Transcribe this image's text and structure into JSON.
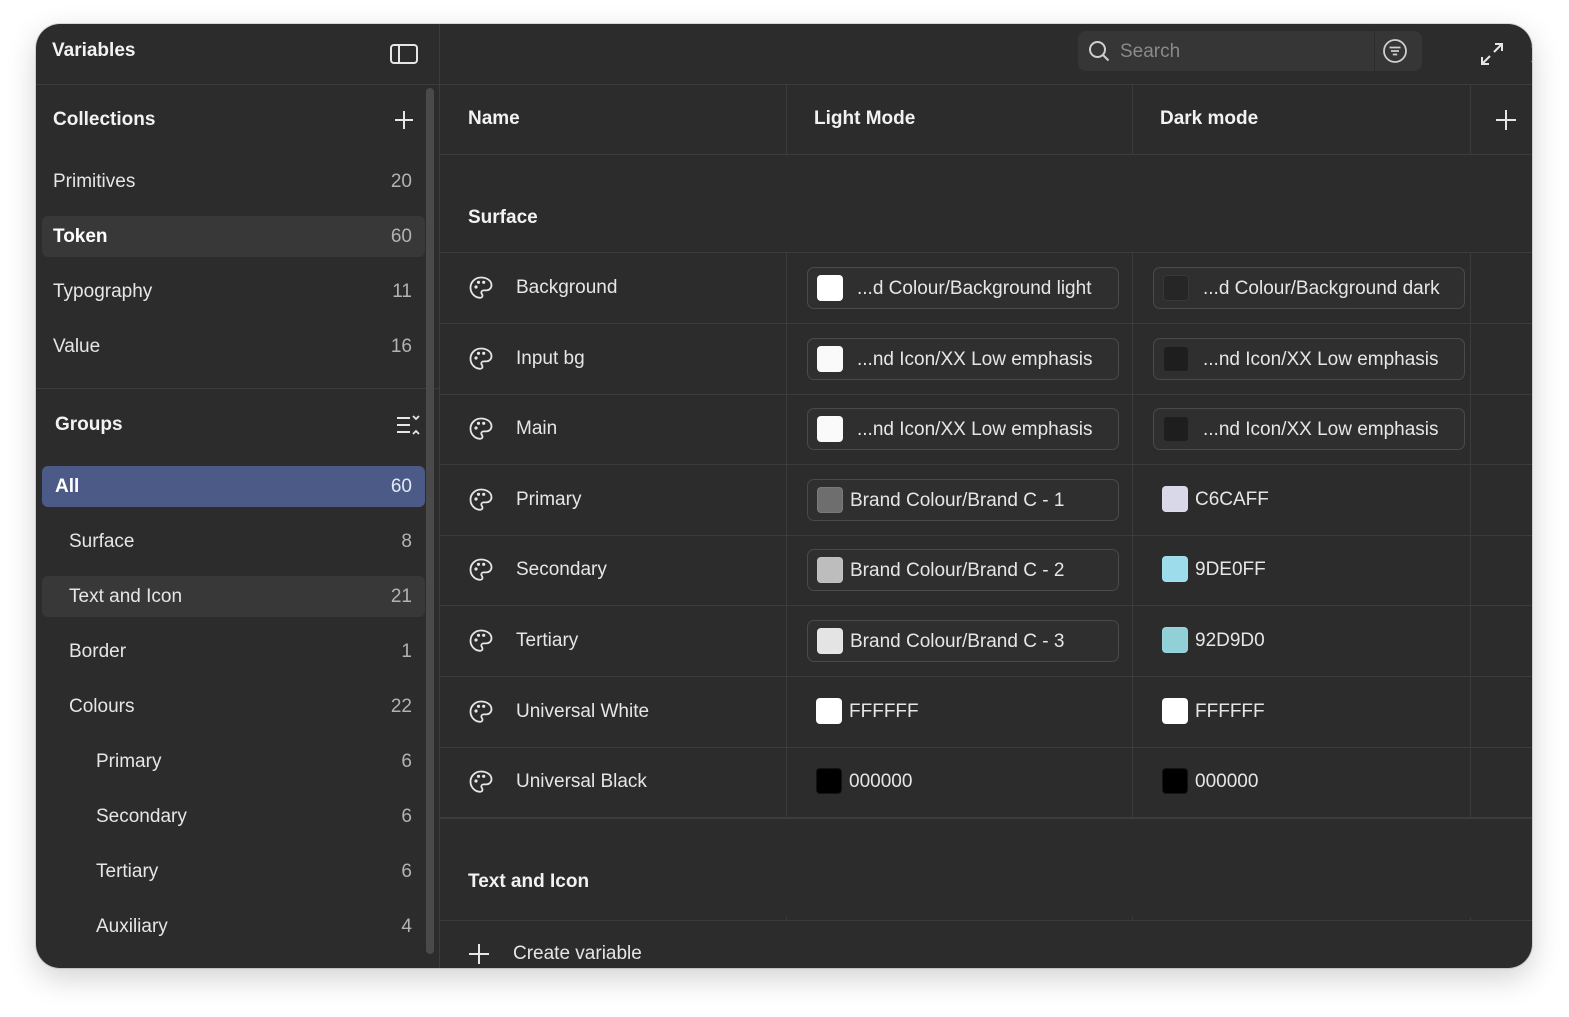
{
  "sidebar": {
    "title": "Variables",
    "collections_label": "Collections",
    "collections": [
      {
        "label": "Primitives",
        "count": "20"
      },
      {
        "label": "Token",
        "count": "60"
      },
      {
        "label": "Typography",
        "count": "11"
      },
      {
        "label": "Value",
        "count": "16"
      }
    ],
    "groups_label": "Groups",
    "groups": [
      {
        "label": "All",
        "count": "60"
      },
      {
        "label": "Surface",
        "count": "8"
      },
      {
        "label": "Text and Icon",
        "count": "21"
      },
      {
        "label": "Border",
        "count": "1"
      },
      {
        "label": "Colours",
        "count": "22"
      },
      {
        "label": "Primary",
        "count": "6"
      },
      {
        "label": "Secondary",
        "count": "6"
      },
      {
        "label": "Tertiary",
        "count": "6"
      },
      {
        "label": "Auxiliary",
        "count": "4"
      }
    ]
  },
  "search": {
    "placeholder": "Search"
  },
  "columns": {
    "name": "Name",
    "light": "Light Mode",
    "dark": "Dark mode"
  },
  "groups": [
    {
      "title": "Surface",
      "rows": [
        {
          "name": "Background",
          "light": {
            "type": "alias",
            "text": "...d Colour/Background light",
            "color": "#ffffff"
          },
          "dark": {
            "type": "alias",
            "text": "...d Colour/Background dark",
            "color": "#262626"
          }
        },
        {
          "name": "Input bg",
          "light": {
            "type": "alias",
            "text": "...nd Icon/XX Low emphasis",
            "color": "#fafafa"
          },
          "dark": {
            "type": "alias",
            "text": "...nd Icon/XX Low emphasis",
            "color": "#1e1e1e"
          }
        },
        {
          "name": "Main",
          "light": {
            "type": "alias",
            "text": "...nd Icon/XX Low emphasis",
            "color": "#fafafa"
          },
          "dark": {
            "type": "alias",
            "text": "...nd Icon/XX Low emphasis",
            "color": "#1e1e1e"
          }
        },
        {
          "name": "Primary",
          "light": {
            "type": "alias",
            "text": "Brand Colour/Brand C - 1",
            "color": "#6e6e6e"
          },
          "dark": {
            "type": "hex",
            "text": "C6CAFF",
            "color": "#d8d8e8"
          }
        },
        {
          "name": "Secondary",
          "light": {
            "type": "alias",
            "text": "Brand Colour/Brand C - 2",
            "color": "#bdbdbd"
          },
          "dark": {
            "type": "hex",
            "text": "9DE0FF",
            "color": "#9ddcea"
          }
        },
        {
          "name": "Tertiary",
          "light": {
            "type": "alias",
            "text": "Brand Colour/Brand C - 3",
            "color": "#e4e4e4"
          },
          "dark": {
            "type": "hex",
            "text": "92D9D0",
            "color": "#92d0d8"
          }
        },
        {
          "name": "Universal White",
          "light": {
            "type": "hex",
            "text": "FFFFFF",
            "color": "#ffffff"
          },
          "dark": {
            "type": "hex",
            "text": "FFFFFF",
            "color": "#ffffff"
          }
        },
        {
          "name": "Universal Black",
          "light": {
            "type": "hex",
            "text": "000000",
            "color": "#000000"
          },
          "dark": {
            "type": "hex",
            "text": "000000",
            "color": "#000000"
          }
        }
      ]
    },
    {
      "title": "Text and Icon",
      "rows": []
    }
  ],
  "create_label": "Create variable",
  "colors": {
    "selected": "#4b5a87",
    "panel": "#2c2c2c"
  },
  "icons": [
    "panel-toggle-icon",
    "plus-icon",
    "collapse-groups-icon",
    "search-icon",
    "filter-icon",
    "expand-icon",
    "close-icon",
    "palette-icon"
  ]
}
